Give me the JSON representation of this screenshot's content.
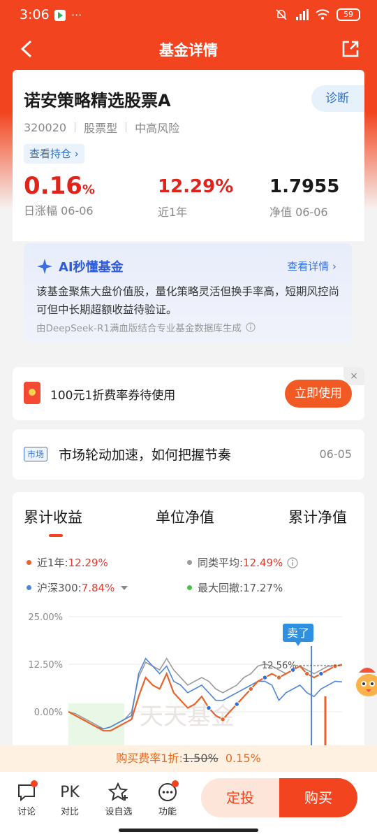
{
  "status_bar": {
    "time": "3:06",
    "more": "···",
    "battery": "59"
  },
  "nav": {
    "title": "基金详情"
  },
  "fund": {
    "name": "诺安策略精选股票A",
    "code": "320020",
    "type": "股票型",
    "risk": "中高风险",
    "diagnose_label": "诊断",
    "holdings_label": "查看持仓",
    "daily_change": "0.16",
    "daily_change_unit": "%",
    "daily_label": "日涨幅 06-06",
    "year_return": "12.29%",
    "year_label": "近1年",
    "nav_value": "1.7955",
    "nav_label": "净值 06-06"
  },
  "ai": {
    "title": "AI秒懂基金",
    "more": "查看详情",
    "text": "该基金聚焦大盘价值股，量化策略灵活但换手率高，短期风控尚可但中长期超额收益待验证。",
    "footer": "由DeepSeek-R1满血版结合专业基金数据库生成"
  },
  "coupon": {
    "text": "100元1折费率券待使用",
    "button": "立即使用",
    "close": "×"
  },
  "news": {
    "tag": "市场",
    "title": "市场轮动加速，如何把握节奏",
    "date": "06-05"
  },
  "chart_tabs": [
    "累计收益",
    "单位净值",
    "累计净值"
  ],
  "legend": {
    "fund_label": "近1年:",
    "fund_value": "12.29%",
    "peer_label": "同类平均:",
    "peer_value": "12.49%",
    "index_label": "沪深300:",
    "index_value": "7.84%",
    "drawdown_label": "最大回撤:",
    "drawdown_value": "17.27%"
  },
  "chart_annotations": {
    "sell_label": "卖了",
    "peak_label": "12.56%",
    "watermark": "天天基金"
  },
  "chart_data": {
    "type": "line",
    "ylim": [
      -5,
      25
    ],
    "yticks": [
      "25.00%",
      "12.50%",
      "0.00%"
    ],
    "colors": {
      "fund": "#e8622b",
      "peer": "#9a9a9a",
      "index": "#4f86d8",
      "drawdown": "#4bbd4b"
    },
    "series": [
      {
        "name": "近1年",
        "values": [
          0,
          -1,
          -2,
          -3,
          -4,
          -5,
          -5,
          -4,
          -3,
          -2,
          4,
          9,
          7,
          6,
          10,
          5,
          3,
          1,
          2,
          4,
          1,
          -1,
          -2,
          0,
          2,
          4,
          6,
          8,
          9,
          10,
          9,
          10,
          11,
          12,
          10,
          9,
          10,
          11,
          12,
          12.29
        ]
      },
      {
        "name": "同类平均",
        "values": [
          0,
          -0.5,
          -1.5,
          -2.5,
          -3.5,
          -4.5,
          -4,
          -3,
          -2,
          0,
          9,
          13,
          12,
          11,
          14,
          11,
          9,
          7,
          8,
          9,
          8,
          6,
          5,
          6,
          7,
          9,
          10,
          12,
          12.56,
          12,
          11,
          10,
          11,
          12,
          11,
          10,
          11,
          12,
          12,
          12.49
        ]
      },
      {
        "name": "沪深300",
        "values": [
          0,
          -1,
          -2,
          -3,
          -4,
          -4.5,
          -4,
          -3,
          -2,
          -1,
          10,
          14,
          12,
          10,
          12,
          8,
          7,
          5,
          6,
          7,
          5,
          3,
          3,
          4,
          5,
          6,
          7,
          8,
          8,
          7,
          3,
          5,
          6,
          7,
          5,
          4,
          6,
          7,
          8,
          7.84
        ]
      }
    ]
  }
}
